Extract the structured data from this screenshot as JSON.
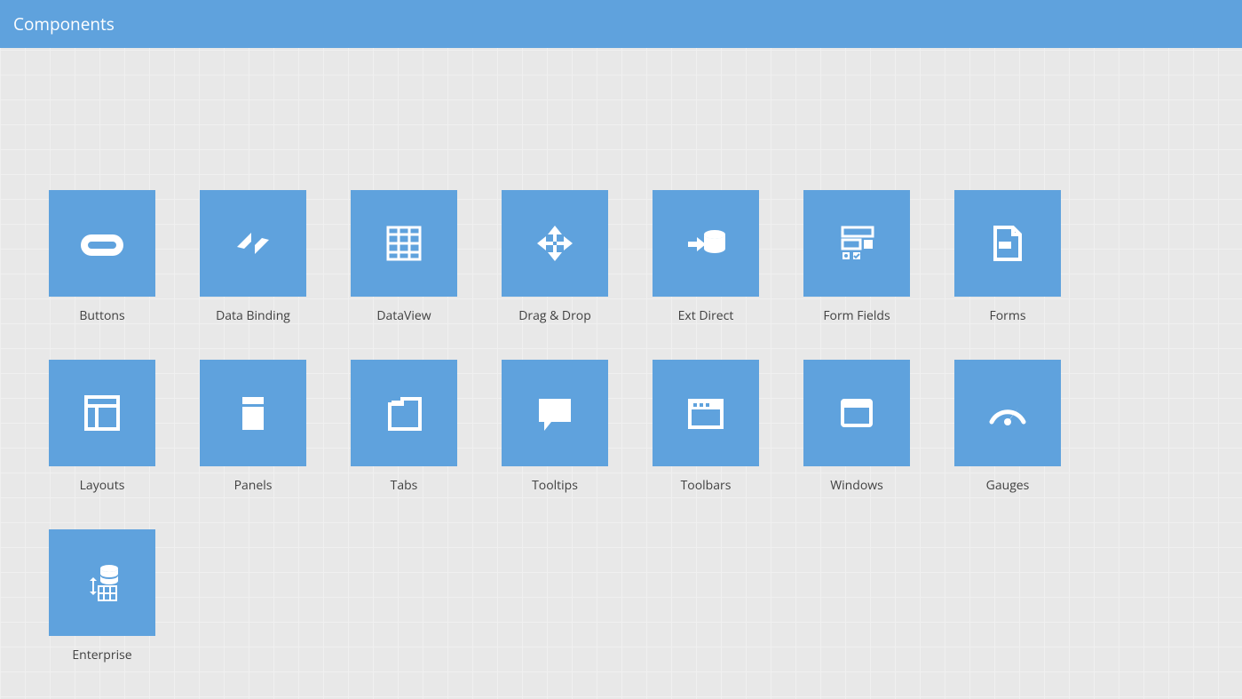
{
  "header": {
    "title": "Components"
  },
  "tiles": [
    {
      "label": "Buttons",
      "icon": "button-icon"
    },
    {
      "label": "Data Binding",
      "icon": "data-binding-icon"
    },
    {
      "label": "DataView",
      "icon": "dataview-icon"
    },
    {
      "label": "Drag & Drop",
      "icon": "drag-drop-icon"
    },
    {
      "label": "Ext Direct",
      "icon": "ext-direct-icon"
    },
    {
      "label": "Form Fields",
      "icon": "form-fields-icon"
    },
    {
      "label": "Forms",
      "icon": "forms-icon"
    },
    {
      "label": "Layouts",
      "icon": "layouts-icon"
    },
    {
      "label": "Panels",
      "icon": "panels-icon"
    },
    {
      "label": "Tabs",
      "icon": "tabs-icon"
    },
    {
      "label": "Tooltips",
      "icon": "tooltips-icon"
    },
    {
      "label": "Toolbars",
      "icon": "toolbars-icon"
    },
    {
      "label": "Windows",
      "icon": "windows-icon"
    },
    {
      "label": "Gauges",
      "icon": "gauges-icon"
    },
    {
      "label": "Enterprise",
      "icon": "enterprise-icon"
    }
  ],
  "colors": {
    "accent": "#5fa2dd",
    "text": "#404040",
    "iconFill": "#ffffff"
  }
}
